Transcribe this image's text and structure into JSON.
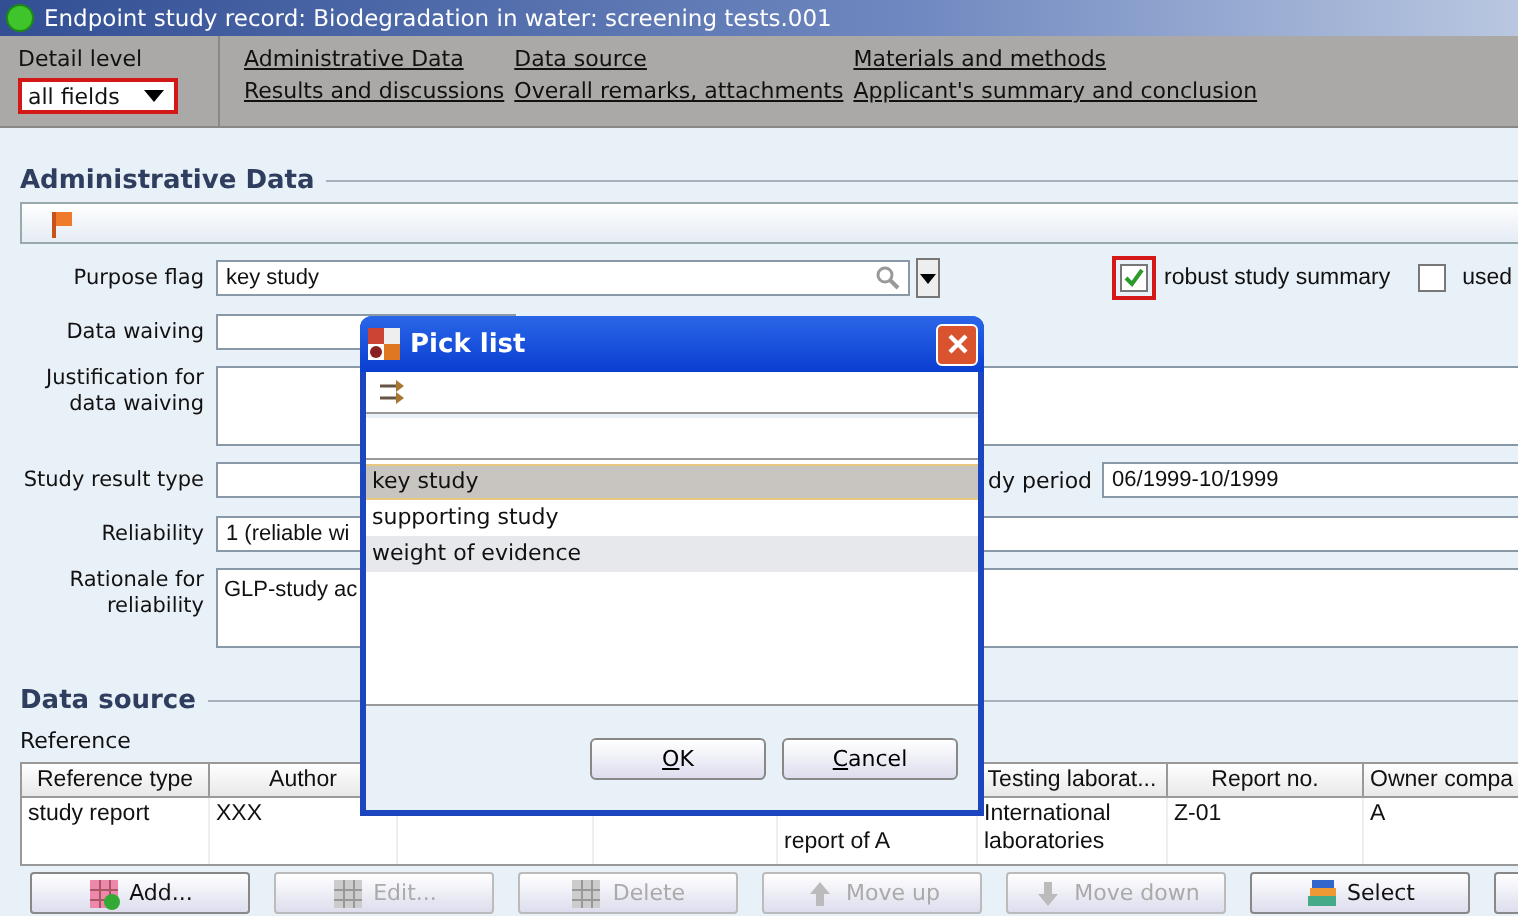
{
  "window": {
    "title": "Endpoint study record: Biodegradation in water: screening tests.001"
  },
  "detail_level": {
    "label": "Detail level",
    "value": "all fields",
    "highlighted": true
  },
  "nav_links": [
    {
      "label": "Administrative Data"
    },
    {
      "label": "Data source"
    },
    {
      "label": "Materials and methods"
    },
    {
      "label": "Results and discussions"
    },
    {
      "label": "Overall remarks, attachments"
    },
    {
      "label": "Applicant's summary and conclusion"
    }
  ],
  "administrative_data": {
    "heading": "Administrative Data",
    "purpose_flag": {
      "label": "Purpose flag",
      "value": "key study"
    },
    "checkboxes": [
      {
        "label": "robust study summary",
        "checked": true,
        "highlighted": true
      },
      {
        "label": "used",
        "checked": false,
        "highlighted": false
      }
    ],
    "data_waiving": {
      "label": "Data waiving"
    },
    "justification": {
      "label": "Justification for data waiving"
    },
    "study_result_type": {
      "label": "Study result type"
    },
    "study_period": {
      "label": "dy period",
      "value": "06/1999-10/1999"
    },
    "reliability": {
      "label": "Reliability",
      "value": "1 (reliable wi"
    },
    "rationale": {
      "label": "Rationale for reliability",
      "value": "GLP-study ac"
    }
  },
  "data_source": {
    "heading": "Data source",
    "reference_label": "Reference",
    "columns": [
      "Reference type",
      "Author",
      "Testing laborat...",
      "Report no.",
      "Owner compa"
    ],
    "rows": [
      {
        "reference_type": "study report",
        "author": "XXX",
        "column_5": "report of A",
        "testing_laborat": "International laboratories",
        "report_no": "Z-01",
        "owner_compa": "A"
      }
    ],
    "buttons": [
      {
        "label": "Add...",
        "kind": "add",
        "disabled": false
      },
      {
        "label": "Edit...",
        "kind": "edit",
        "disabled": true
      },
      {
        "label": "Delete",
        "kind": "delete",
        "disabled": true
      },
      {
        "label": "Move up",
        "kind": "up",
        "disabled": true
      },
      {
        "label": "Move down",
        "kind": "down",
        "disabled": true
      },
      {
        "label": "Select",
        "kind": "select",
        "disabled": false
      },
      {
        "kind": "plain",
        "disabled": false
      }
    ]
  },
  "pick_list": {
    "title": "Pick list",
    "items": [
      {
        "label": "key study",
        "selected": true
      },
      {
        "label": "supporting study",
        "selected": false
      },
      {
        "label": "weight of evidence",
        "selected": false
      }
    ],
    "buttons": [
      "OK",
      "Cancel"
    ]
  }
}
